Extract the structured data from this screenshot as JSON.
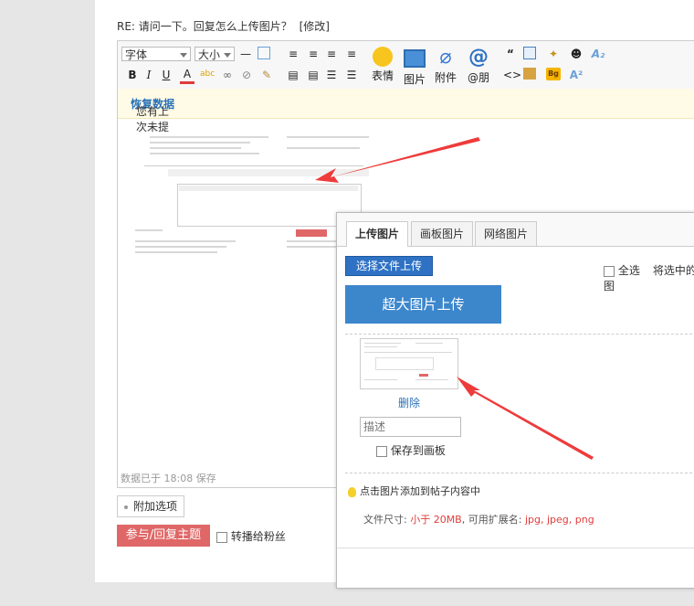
{
  "reply": {
    "prefix": "RE: ",
    "title": "请问一下。回复怎么上传图片？",
    "edit_link": "[修改]"
  },
  "toolbar": {
    "font_select": "字体",
    "size_select": "大小",
    "bold": "B",
    "italic": "I",
    "underline": "U",
    "font_color": "A",
    "emoji_label": "表情",
    "image_label": "图片",
    "attach_label": "附件",
    "mention_label": "@朋",
    "quote_icon": "“",
    "code_icon": "<>",
    "bg_icon": "Bg"
  },
  "restore": {
    "message": "您有上次未提交成功的数据",
    "link": "恢复数据"
  },
  "editor": {
    "saved_status": "数据已于 18:08 保存"
  },
  "options_button": "附加选项",
  "submit_button": "参与/回复主题",
  "forward_fans": "转播给粉丝",
  "dialog": {
    "tabs": [
      "上传图片",
      "画板图片",
      "网络图片"
    ],
    "choose_button": "选择文件上传",
    "super_button": "超大图片上传",
    "select_all": "全选",
    "selected_text": "将选中的图",
    "delete_link": "删除",
    "description_placeholder": "描述",
    "save_to_board": "保存到画板",
    "tip": "点击图片添加到帖子内容中",
    "file_size_label": "文件尺寸: ",
    "file_size_value": "小于 20MB",
    "ext_label": ", 可用扩展名: ",
    "ext_value": "jpg, jpeg, png"
  },
  "colors": {
    "accent": "#e06767",
    "blue": "#2f72c4",
    "arrow": "#ee3b3b"
  }
}
